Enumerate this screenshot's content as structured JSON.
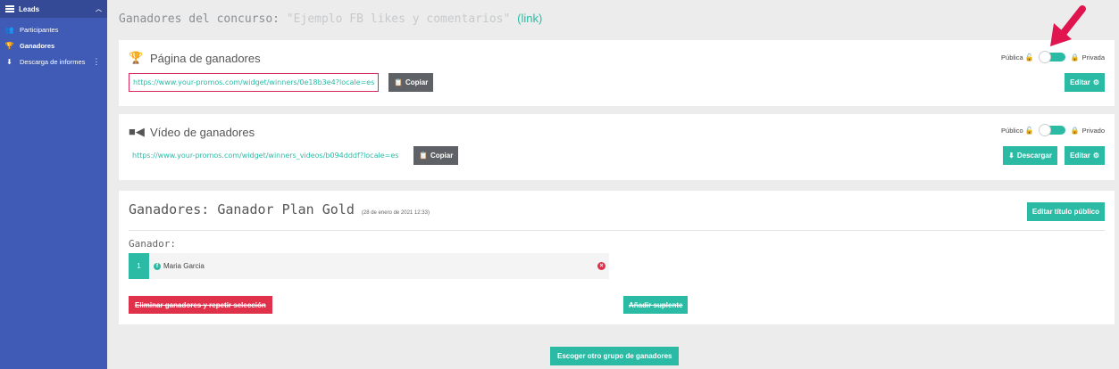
{
  "sidebar": {
    "header": "Leads",
    "items": [
      {
        "label": "Participantes",
        "icon": "users-icon"
      },
      {
        "label": "Ganadores",
        "icon": "trophy-icon"
      },
      {
        "label": "Descarga de informes",
        "icon": "download-icon"
      }
    ]
  },
  "page": {
    "title_prefix": "Ganadores del concurso:",
    "contest_name": "\"Ejemplo FB likes y comentarios\"",
    "link_label": "(link)"
  },
  "winners_page": {
    "title": "Página de ganadores",
    "icon": "trophy-icon",
    "url": "https://www.your-promos.com/widget/winners/0e18b3e4?locale=es",
    "copy_label": "Copiar",
    "public_label": "Pública",
    "private_label": "Privada",
    "edit_label": "Editar"
  },
  "winners_video": {
    "title": "Vídeo de ganadores",
    "icon": "video-icon",
    "url": "https://www.your-promos.com/widget/winners_videos/b094dddf?locale=es",
    "copy_label": "Copiar",
    "public_label": "Público",
    "private_label": "Privado",
    "download_label": "Descargar",
    "edit_label": "Editar"
  },
  "group": {
    "title": "Ganadores: Ganador Plan Gold",
    "date": "(28 de enero de 2021 12:33)",
    "edit_title_label": "Editar título público",
    "winner_label": "Ganador:",
    "winners": [
      {
        "number": "1",
        "name": "Maria Garcia"
      }
    ],
    "delete_label": "Eliminar ganadores y repetir selección",
    "add_substitute_label": "Añadir suplente"
  },
  "footer": {
    "choose_other_label": "Escoger otro grupo de ganadores"
  },
  "colors": {
    "accent": "#2bbba5",
    "sidebar": "#3f5bb6",
    "danger": "#e0314b",
    "highlight": "#d8285a"
  }
}
